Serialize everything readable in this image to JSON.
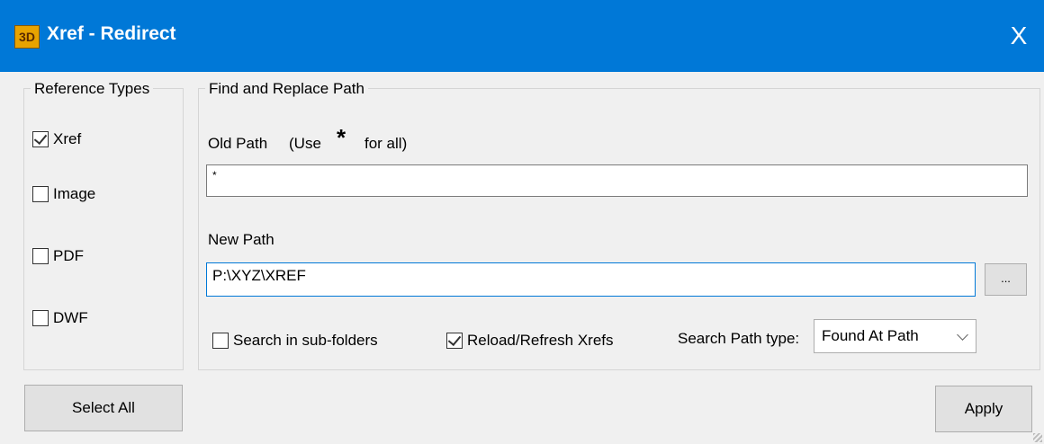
{
  "window": {
    "title": "Xref - Redirect",
    "icon": "app-logo-icon",
    "close_glyph": "X"
  },
  "reference_types": {
    "legend": "Reference Types",
    "items": [
      {
        "label": "Xref",
        "checked": true
      },
      {
        "label": "Image",
        "checked": false
      },
      {
        "label": "PDF",
        "checked": false
      },
      {
        "label": "DWF",
        "checked": false
      }
    ],
    "select_all_label": "Select All"
  },
  "find_replace": {
    "legend": "Find and Replace Path",
    "old_path_label": "Old Path",
    "use_label": "(Use",
    "asterisk": "*",
    "for_all_label": "for all)",
    "old_path_value": "*",
    "new_path_label": "New Path",
    "new_path_value": "P:\\XYZ\\XREF",
    "browse_label": "...",
    "search_subfolders_label": "Search in sub-folders",
    "search_subfolders_checked": false,
    "reload_label": "Reload/Refresh Xrefs",
    "reload_checked": true,
    "search_path_type_label": "Search Path type:",
    "search_path_type_value": "Found At Path"
  },
  "apply_label": "Apply",
  "colors": {
    "titlebar": "#0078d7",
    "window_bg": "#f0f0f0",
    "button_bg": "#e1e1e1"
  }
}
